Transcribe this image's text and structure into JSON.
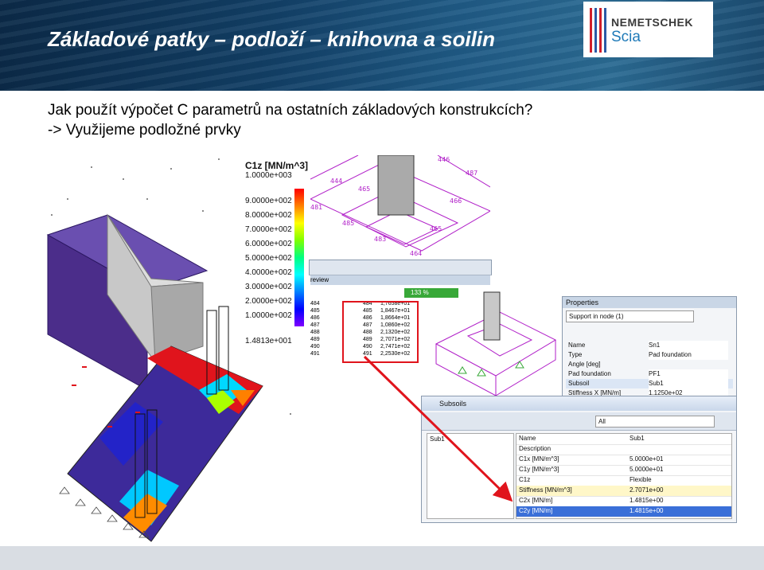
{
  "header": {
    "title": "Základové patky – podloží – knihovna a soilin",
    "logo_name": "NEMETSCHEK",
    "logo_sub": "Scia"
  },
  "text": {
    "line1": "Jak použít výpočet C parametrů na ostatních základových konstrukcích?",
    "line2": "-> Využijeme podložné prvky"
  },
  "legend": {
    "title": "C1z [MN/m^3]",
    "top": "1.0000e+003",
    "values": [
      "9.0000e+002",
      "8.0000e+002",
      "7.0000e+002",
      "6.0000e+002",
      "5.0000e+002",
      "4.0000e+002",
      "3.0000e+002",
      "2.0000e+002",
      "1.0000e+002"
    ],
    "bottom": "1.4813e+001"
  },
  "preview": {
    "label": "review",
    "zoom": "133 %",
    "rows": [
      [
        "484",
        "484",
        "1,7658e+01"
      ],
      [
        "485",
        "485",
        "1,8467e+01"
      ],
      [
        "486",
        "486",
        "1,8664e+01"
      ],
      [
        "487",
        "487",
        "1,0860e+02"
      ],
      [
        "488",
        "488",
        "2,1320e+02"
      ],
      [
        "489",
        "489",
        "2,7071e+02"
      ],
      [
        "490",
        "490",
        "2,7471e+02"
      ],
      [
        "491",
        "491",
        "2,2530e+02"
      ]
    ],
    "node_labels": [
      "446",
      "444",
      "487",
      "465",
      "485",
      "483",
      "464",
      "481",
      "466",
      "465"
    ]
  },
  "properties": {
    "title": "Properties",
    "dropdown": "Support in node (1)",
    "rows": [
      [
        "Name",
        "Sn1"
      ],
      [
        "Type",
        "Pad foundation"
      ],
      [
        "Angle [deg]",
        ""
      ],
      [
        "Pad foundation",
        "PF1"
      ],
      [
        "Subsoil",
        "Sub1"
      ],
      [
        "Stiffness X [MN/m]",
        "1.1250e+02"
      ]
    ]
  },
  "subsoils": {
    "title": "Subsoils",
    "filter": "All",
    "list": [
      "Sub1"
    ],
    "rows": [
      [
        "Name",
        "Sub1"
      ],
      [
        "Description",
        ""
      ],
      [
        "C1x [MN/m^3]",
        "5.0000e+01"
      ],
      [
        "C1y [MN/m^3]",
        "5.0000e+01"
      ],
      [
        "C1z",
        "Flexible"
      ],
      [
        "Stiffness [MN/m^3]",
        "2.7071e+00"
      ],
      [
        "C2x [MN/m]",
        "1.4815e+00"
      ],
      [
        "C2y [MN/m]",
        "1.4815e+00"
      ]
    ]
  },
  "colors": {
    "header_dark": "#0b2a48",
    "highlight_red": "#e0141c",
    "purple": "#4a2a8c",
    "blue_select": "#3a6fd8"
  }
}
